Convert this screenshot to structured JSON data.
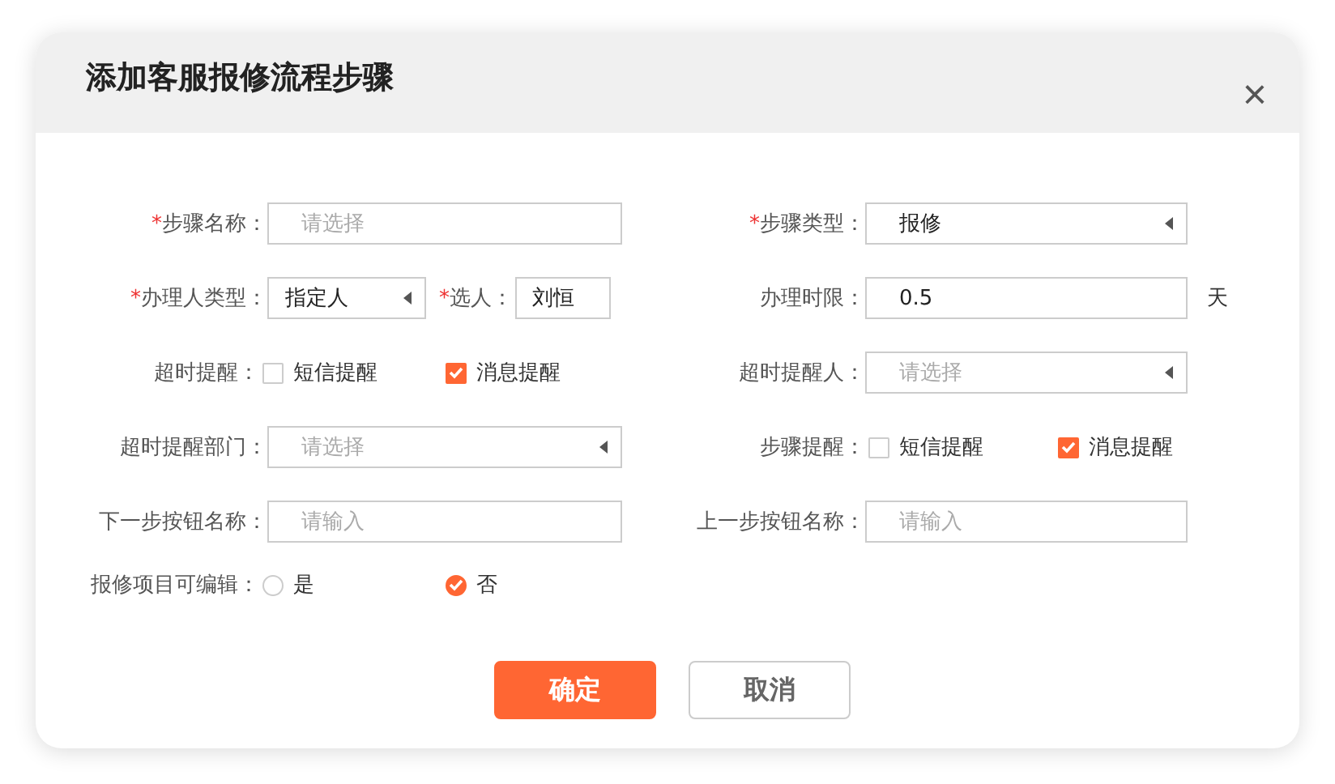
{
  "dialog": {
    "title": "添加客服报修流程步骤",
    "close": "×"
  },
  "rows": [
    {
      "left": [
        {
          "kind": "input",
          "required_mark": "*",
          "label": "步骤名称：",
          "placeholder": "请选择"
        }
      ],
      "right": [
        {
          "kind": "select",
          "required_mark": "*",
          "label": "步骤类型：",
          "value": "报修"
        }
      ]
    },
    {
      "left": [
        {
          "kind": "select",
          "required_mark": "*",
          "label": "办理人类型：",
          "value": "指定人"
        },
        {
          "kind": "input",
          "required_mark": "*",
          "label": "选人：",
          "value": "刘恒"
        }
      ],
      "right": [
        {
          "kind": "input",
          "label": "办理时限：",
          "value": "0.5",
          "unit": "天"
        }
      ]
    },
    {
      "left": [
        {
          "kind": "checks",
          "label": "超时提醒：",
          "options": [
            {
              "label": "短信提醒",
              "checked": false
            },
            {
              "label": "消息提醒",
              "checked": true
            }
          ]
        }
      ],
      "right": [
        {
          "kind": "select",
          "label": "超时提醒人：",
          "placeholder": "请选择"
        }
      ]
    },
    {
      "left": [
        {
          "kind": "select",
          "label": "超时提醒部门：",
          "placeholder": "请选择"
        }
      ],
      "right": [
        {
          "kind": "checks",
          "label": "步骤提醒：",
          "options": [
            {
              "label": "短信提醒",
              "checked": false
            },
            {
              "label": "消息提醒",
              "checked": true
            }
          ]
        }
      ]
    },
    {
      "left": [
        {
          "kind": "input",
          "label": "下一步按钮名称：",
          "placeholder": "请输入"
        }
      ],
      "right": [
        {
          "kind": "input",
          "label": "上一步按钮名称：",
          "placeholder": "请输入"
        }
      ]
    },
    {
      "left": [
        {
          "kind": "radios",
          "label": "报修项目可编辑：",
          "options": [
            {
              "label": "是",
              "selected": false
            },
            {
              "label": "否",
              "selected": true
            }
          ]
        }
      ]
    }
  ],
  "buttons": [
    {
      "label": "确定",
      "kind": "primary"
    },
    {
      "label": "取消",
      "kind": "secondary"
    }
  ]
}
